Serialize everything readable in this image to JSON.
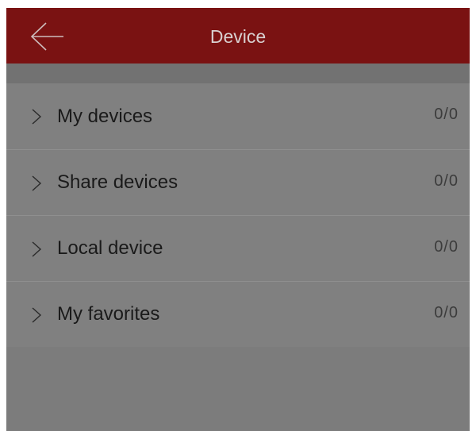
{
  "header": {
    "title": "Device",
    "back_icon": "arrow-left-icon"
  },
  "list": {
    "items": [
      {
        "label": "My devices",
        "count": "0/0",
        "icon": "chevron-right-icon"
      },
      {
        "label": "Share devices",
        "count": "0/0",
        "icon": "chevron-right-icon"
      },
      {
        "label": "Local device",
        "count": "0/0",
        "icon": "chevron-right-icon"
      },
      {
        "label": "My favorites",
        "count": "0/0",
        "icon": "chevron-right-icon"
      }
    ]
  },
  "colors": {
    "header_bg": "#7a1212",
    "overlay_bg": "#7c7c7c",
    "row_bg": "#808080"
  }
}
